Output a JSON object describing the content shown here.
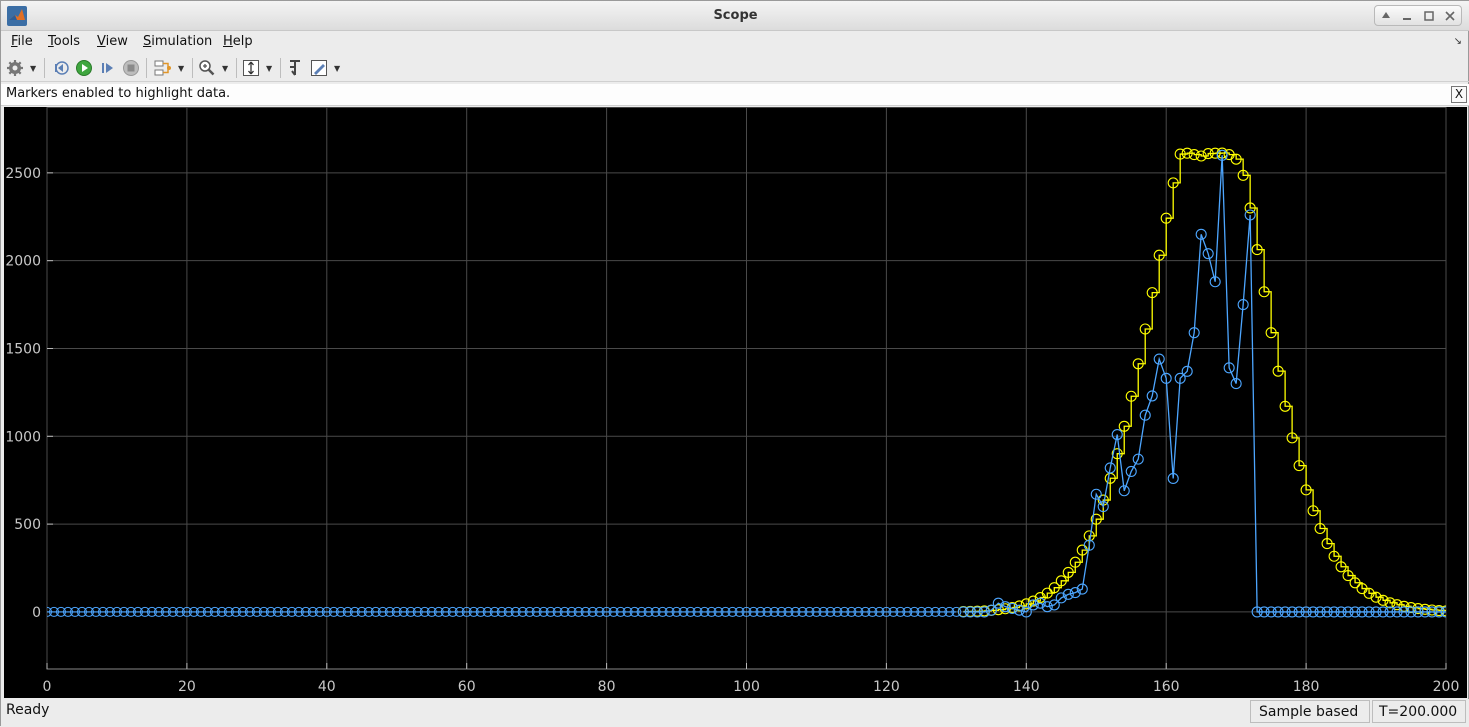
{
  "window": {
    "title": "Scope"
  },
  "menu": {
    "items": [
      {
        "label": "File",
        "underline": "F",
        "rest": "ile"
      },
      {
        "label": "Tools",
        "underline": "T",
        "rest": "ools"
      },
      {
        "label": "View",
        "underline": "V",
        "rest": "iew"
      },
      {
        "label": "Simulation",
        "underline": "S",
        "rest": "imulation"
      },
      {
        "label": "Help",
        "underline": "H",
        "rest": "elp"
      }
    ]
  },
  "toolbar": {
    "icons": [
      "gear-icon",
      "step-back-icon",
      "run-icon",
      "step-forward-icon",
      "stop-icon",
      "signal-selector-icon",
      "zoom-in-icon",
      "autoscale-icon",
      "legend-icon",
      "highlight-icon"
    ]
  },
  "info": {
    "message": "Markers enabled to highlight data.",
    "close_label": "X"
  },
  "status": {
    "text": "Ready",
    "mode": "Sample based",
    "time": "T=200.000"
  },
  "colors": {
    "series_yellow": "#ffff00",
    "series_blue": "#4da6ff",
    "background": "#000000",
    "grid": "#4a4a4a",
    "axis_text": "#c8c8c8"
  },
  "chart_data": {
    "type": "line",
    "xlim": [
      0,
      200
    ],
    "ylim": [
      -325,
      2875
    ],
    "x_ticks": [
      0,
      20,
      40,
      60,
      80,
      100,
      120,
      140,
      160,
      180,
      200
    ],
    "y_ticks": [
      0,
      500,
      1000,
      1500,
      2000,
      2500
    ],
    "grid": true,
    "markers": "circle",
    "series": [
      {
        "color": "#ffff00",
        "stairs": true,
        "x": [
          131,
          132,
          133,
          134,
          135,
          136,
          137,
          138,
          139,
          140,
          141,
          142,
          143,
          144,
          145,
          146,
          147,
          148,
          149,
          150,
          151,
          152,
          153,
          154,
          155,
          156,
          157,
          158,
          159,
          160,
          161,
          162,
          163,
          164,
          165,
          166,
          167,
          168,
          169,
          170,
          171,
          172,
          173,
          174,
          175,
          176,
          177,
          178,
          179,
          180,
          181,
          182,
          183,
          184,
          185,
          186,
          187,
          188,
          189,
          190,
          191,
          192,
          193,
          194,
          195,
          196,
          197,
          198,
          199,
          200
        ],
        "values": [
          2,
          3,
          4,
          6,
          9,
          13,
          18,
          25,
          34,
          46,
          62,
          82,
          107,
          138,
          177,
          225,
          283,
          352,
          433,
          528,
          637,
          761,
          901,
          1057,
          1228,
          1413,
          1611,
          1818,
          2031,
          2242,
          2443,
          2607,
          2612,
          2604,
          2596,
          2610,
          2612,
          2613,
          2604,
          2578,
          2486,
          2300,
          2063,
          1823,
          1590,
          1371,
          1171,
          991,
          833,
          695,
          576,
          475,
          389,
          317,
          257,
          207,
          166,
          133,
          106,
          84,
          66,
          52,
          41,
          32,
          25,
          19,
          15,
          11,
          8,
          6
        ]
      },
      {
        "color": "#4da6ff",
        "stairs": false,
        "x": [
          131,
          132,
          133,
          134,
          135,
          136,
          137,
          138,
          139,
          140,
          141,
          142,
          143,
          144,
          145,
          146,
          147,
          148,
          149,
          150,
          151,
          152,
          153,
          154,
          155,
          156,
          157,
          158,
          159,
          160,
          161,
          162,
          163,
          164,
          165,
          166,
          167,
          168,
          169,
          170,
          171,
          172,
          173,
          174,
          175,
          176,
          177,
          178,
          179,
          180,
          181,
          182,
          183,
          184,
          185,
          186,
          187,
          188,
          189,
          190,
          191,
          192,
          193,
          194,
          195,
          196,
          197,
          198,
          199,
          200
        ],
        "values": [
          0,
          0,
          0,
          0,
          10,
          50,
          30,
          20,
          10,
          0,
          40,
          50,
          30,
          40,
          80,
          100,
          110,
          130,
          380,
          670,
          600,
          820,
          1010,
          690,
          800,
          870,
          1120,
          1230,
          1440,
          1330,
          760,
          1330,
          1370,
          1590,
          2150,
          2040,
          1880,
          2600,
          1390,
          1300,
          1750,
          2260,
          0,
          0,
          0,
          0,
          0,
          0,
          0,
          0,
          0,
          0,
          0,
          0,
          0,
          0,
          0,
          0,
          0,
          0,
          0,
          0,
          0,
          0,
          0,
          0,
          0,
          0,
          0,
          0
        ]
      }
    ],
    "baseline": {
      "x_start": 0,
      "x_end": 130,
      "value": 0,
      "color": "#4da6ff"
    }
  }
}
